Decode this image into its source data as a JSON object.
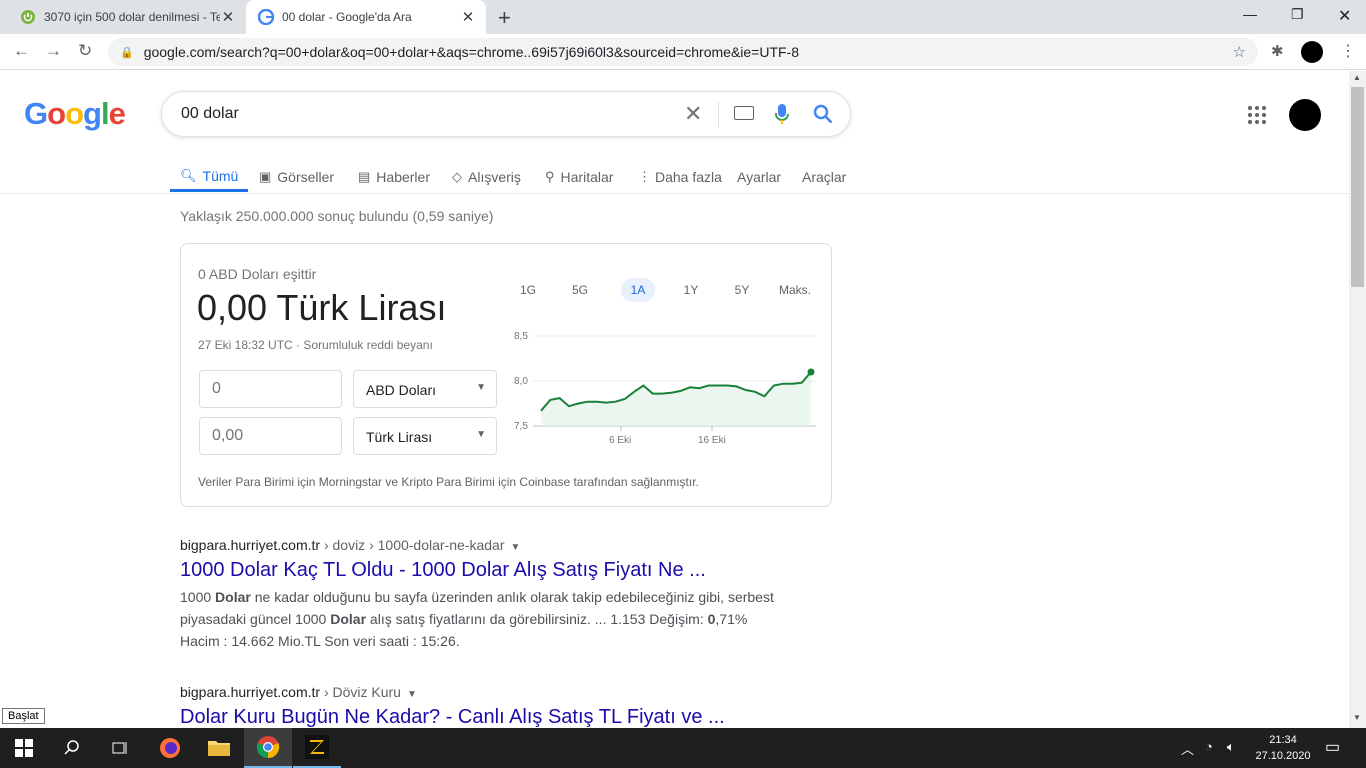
{
  "browser": {
    "tabs": [
      {
        "title": "3070 için 500 dolar denilmesi - Te",
        "active": false
      },
      {
        "title": "00 dolar - Google'da Ara",
        "active": true
      }
    ],
    "url": "google.com/search?q=00+dolar&oq=00+dolar+&aqs=chrome..69i57j69i60l3&sourceid=chrome&ie=UTF-8"
  },
  "google": {
    "logo": "Google",
    "query": "00 dolar",
    "tabs": [
      {
        "label": "Tümü",
        "icon": "search-icon",
        "active": true
      },
      {
        "label": "Görseller",
        "icon": "image-icon"
      },
      {
        "label": "Haberler",
        "icon": "news-icon"
      },
      {
        "label": "Alışveriş",
        "icon": "tag-icon"
      },
      {
        "label": "Haritalar",
        "icon": "pin-icon"
      },
      {
        "label": "Daha fazla",
        "icon": "more-icon"
      },
      {
        "label": "Ayarlar"
      },
      {
        "label": "Araçlar"
      }
    ],
    "stats": "Yaklaşık 250.000.000 sonuç bulundu (0,59 saniye)"
  },
  "converter": {
    "equals": "0 ABD Doları eşittir",
    "result": "0,00 Türk Lirası",
    "timestamp": "27 Eki 18:32 UTC · Sorumluluk reddi beyanı",
    "from_value": "0",
    "from_currency": "ABD Doları",
    "to_value": "0,00",
    "to_currency": "Türk Lirası",
    "ranges": [
      "1G",
      "5G",
      "1A",
      "1Y",
      "5Y",
      "Maks."
    ],
    "active_range": "1A",
    "source": "Veriler Para Birimi için Morningstar ve Kripto Para Birimi için Coinbase tarafından sağlanmıştır."
  },
  "chart_data": {
    "type": "area",
    "x": [
      0,
      1,
      2,
      3,
      4,
      5,
      6,
      7,
      8,
      9,
      10,
      11,
      12,
      13,
      14,
      15,
      16,
      17,
      18,
      19,
      20,
      21,
      22,
      23,
      24,
      25,
      26,
      27,
      28,
      29,
      30,
      31
    ],
    "values": [
      7.67,
      7.79,
      7.81,
      7.72,
      7.75,
      7.77,
      7.77,
      7.76,
      7.77,
      7.8,
      7.88,
      7.95,
      7.86,
      7.86,
      7.87,
      7.89,
      7.93,
      7.92,
      7.95,
      7.95,
      7.95,
      7.94,
      7.9,
      7.88,
      7.83,
      7.95,
      7.97,
      7.97,
      7.98,
      8.1
    ],
    "xticks": [
      "6 Eki",
      "16 Eki"
    ],
    "yticks": [
      "8,5",
      "8,0",
      "7,5"
    ],
    "ylim": [
      7.5,
      8.5
    ],
    "color": "#188038"
  },
  "results": [
    {
      "site": "bigpara.hurriyet.com.tr",
      "path": " › doviz › 1000-dolar-ne-kadar",
      "title": "1000 Dolar Kaç TL Oldu - 1000 Dolar Alış Satış Fiyatı Ne ...",
      "snippet": "1000 Dolar ne kadar olduğunu bu sayfa üzerinden anlık olarak takip edebileceğiniz gibi, serbest piyasadaki güncel 1000 Dolar alış satış fiyatlarını da görebilirsiniz. ... 1.153 Değişim: 0,71% Hacim : 14.662 Mio.TL Son veri saati : 15:26."
    },
    {
      "site": "bigpara.hurriyet.com.tr",
      "path": " › Döviz Kuru",
      "title": "Dolar Kuru Bugün Ne Kadar? - Canlı Alış Satış TL Fiyatı ve ..."
    }
  ],
  "taskbar": {
    "tooltip": "Başlat",
    "time": "21:34",
    "date": "27.10.2020"
  }
}
